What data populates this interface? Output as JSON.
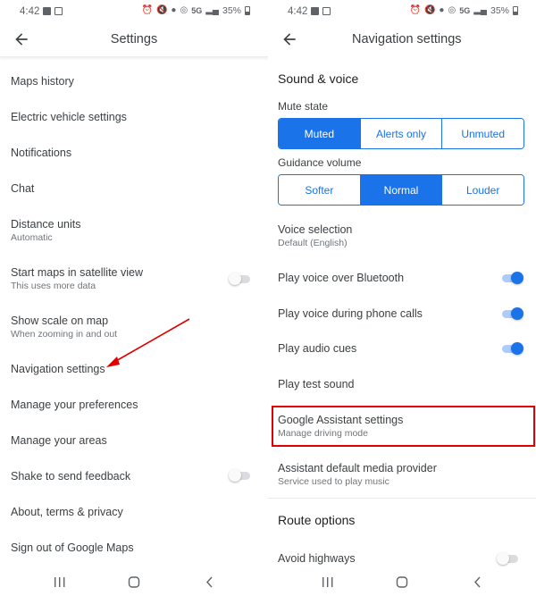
{
  "status_bar": {
    "time": "4:42",
    "network": "5G",
    "battery": "35%"
  },
  "left_screen": {
    "title": "Settings",
    "items": [
      {
        "label": "Maps history"
      },
      {
        "label": "Electric vehicle settings"
      },
      {
        "label": "Notifications"
      },
      {
        "label": "Chat"
      },
      {
        "label": "Distance units",
        "sub": "Automatic"
      },
      {
        "label": "Start maps in satellite view",
        "sub": "This uses more data",
        "toggle": false
      },
      {
        "label": "Show scale on map",
        "sub": "When zooming in and out"
      },
      {
        "label": "Navigation settings"
      },
      {
        "label": "Manage your preferences"
      },
      {
        "label": "Manage your areas"
      },
      {
        "label": "Shake to send feedback",
        "toggle": false
      },
      {
        "label": "About, terms & privacy"
      },
      {
        "label": "Sign out of Google Maps"
      }
    ]
  },
  "right_screen": {
    "title": "Navigation settings",
    "sound_section": "Sound & voice",
    "mute_state": {
      "label": "Mute state",
      "options": [
        "Muted",
        "Alerts only",
        "Unmuted"
      ],
      "selected": "Muted"
    },
    "guidance_volume": {
      "label": "Guidance volume",
      "options": [
        "Softer",
        "Normal",
        "Louder"
      ],
      "selected": "Normal"
    },
    "items": [
      {
        "label": "Voice selection",
        "sub": "Default (English)"
      },
      {
        "label": "Play voice over Bluetooth",
        "toggle": true
      },
      {
        "label": "Play voice during phone calls",
        "toggle": true
      },
      {
        "label": "Play audio cues",
        "toggle": true
      },
      {
        "label": "Play test sound"
      },
      {
        "label": "Google Assistant settings",
        "sub": "Manage driving mode",
        "highlighted": true
      },
      {
        "label": "Assistant default media provider",
        "sub": "Service used to play music"
      }
    ],
    "route_section": "Route options",
    "route_items": [
      {
        "label": "Avoid highways",
        "toggle": false
      }
    ]
  },
  "colors": {
    "accent": "#1a73e8",
    "annotation": "#e00000"
  }
}
